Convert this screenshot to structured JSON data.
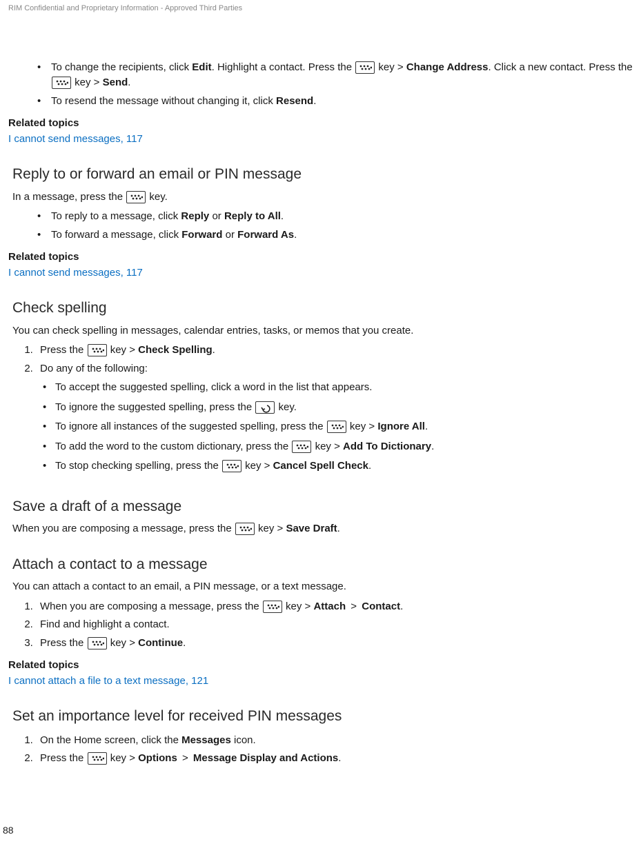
{
  "header": {
    "confidential": "RIM Confidential and Proprietary Information - Approved Third Parties"
  },
  "intro_bullets": {
    "b1": {
      "t1": "To change the recipients, click ",
      "edit": "Edit",
      "t2": ". Highlight a contact. Press the ",
      "t3": " key > ",
      "change_addr": "Change Address",
      "t4": ". Click a new contact. Press the ",
      "t5": " key > ",
      "send": "Send",
      "t6": "."
    },
    "b2": {
      "t1": "To resend the message without changing it, click ",
      "resend": "Resend",
      "t2": "."
    }
  },
  "related1": {
    "heading": "Related topics",
    "link": "I cannot send messages, 117"
  },
  "sec_reply": {
    "title": "Reply to or forward an email or PIN message",
    "intro_a": "In a message, press the ",
    "intro_b": " key.",
    "b1": {
      "t1": "To reply to a message, click ",
      "reply": "Reply",
      "or": " or ",
      "reply_all": "Reply to All",
      "dot": "."
    },
    "b2": {
      "t1": "To forward a message, click ",
      "fwd": "Forward",
      "or": " or ",
      "fwd_as": "Forward As",
      "dot": "."
    }
  },
  "related2": {
    "heading": "Related topics",
    "link": "I cannot send messages, 117"
  },
  "sec_spell": {
    "title": "Check spelling",
    "intro": "You can check spelling in messages, calendar entries, tasks, or memos that you create.",
    "s1": {
      "a": "Press the ",
      "b": " key > ",
      "check": "Check Spelling",
      "dot": "."
    },
    "s2": "Do any of the following:",
    "sb1": "To accept the suggested spelling, click a word in the list that appears.",
    "sb2": {
      "a": "To ignore the suggested spelling, press the ",
      "b": " key."
    },
    "sb3": {
      "a": "To ignore all instances of the suggested spelling, press the ",
      "b": " key > ",
      "ignore": "Ignore All",
      "dot": "."
    },
    "sb4": {
      "a": "To add the word to the custom dictionary, press the ",
      "b": " key > ",
      "add": "Add To Dictionary",
      "dot": "."
    },
    "sb5": {
      "a": "To stop checking spelling, press the ",
      "b": " key > ",
      "cancel": "Cancel Spell Check",
      "dot": "."
    }
  },
  "sec_draft": {
    "title": "Save a draft of a message",
    "a": "When you are composing a message, press the ",
    "b": " key > ",
    "save": "Save Draft",
    "dot": "."
  },
  "sec_attach": {
    "title": "Attach a contact to a message",
    "intro": "You can attach a contact to an email, a PIN message, or a text message.",
    "s1": {
      "a": "When you are composing a message, press the ",
      "b": " key > ",
      "attach": "Attach",
      "gt": " > ",
      "contact": "Contact",
      "dot": "."
    },
    "s2": "Find and highlight a contact.",
    "s3": {
      "a": "Press the ",
      "b": " key > ",
      "cont": "Continue",
      "dot": "."
    }
  },
  "related3": {
    "heading": "Related topics",
    "link": "I cannot attach a file to a text message, 121"
  },
  "sec_importance": {
    "title": "Set an importance level for received PIN messages",
    "s1": {
      "a": "On the Home screen, click the ",
      "msgs": "Messages",
      "b": " icon."
    },
    "s2": {
      "a": "Press the ",
      "b": " key > ",
      "opts": "Options",
      "gt": " > ",
      "mda": "Message Display and Actions",
      "dot": "."
    }
  },
  "page_number": "88"
}
